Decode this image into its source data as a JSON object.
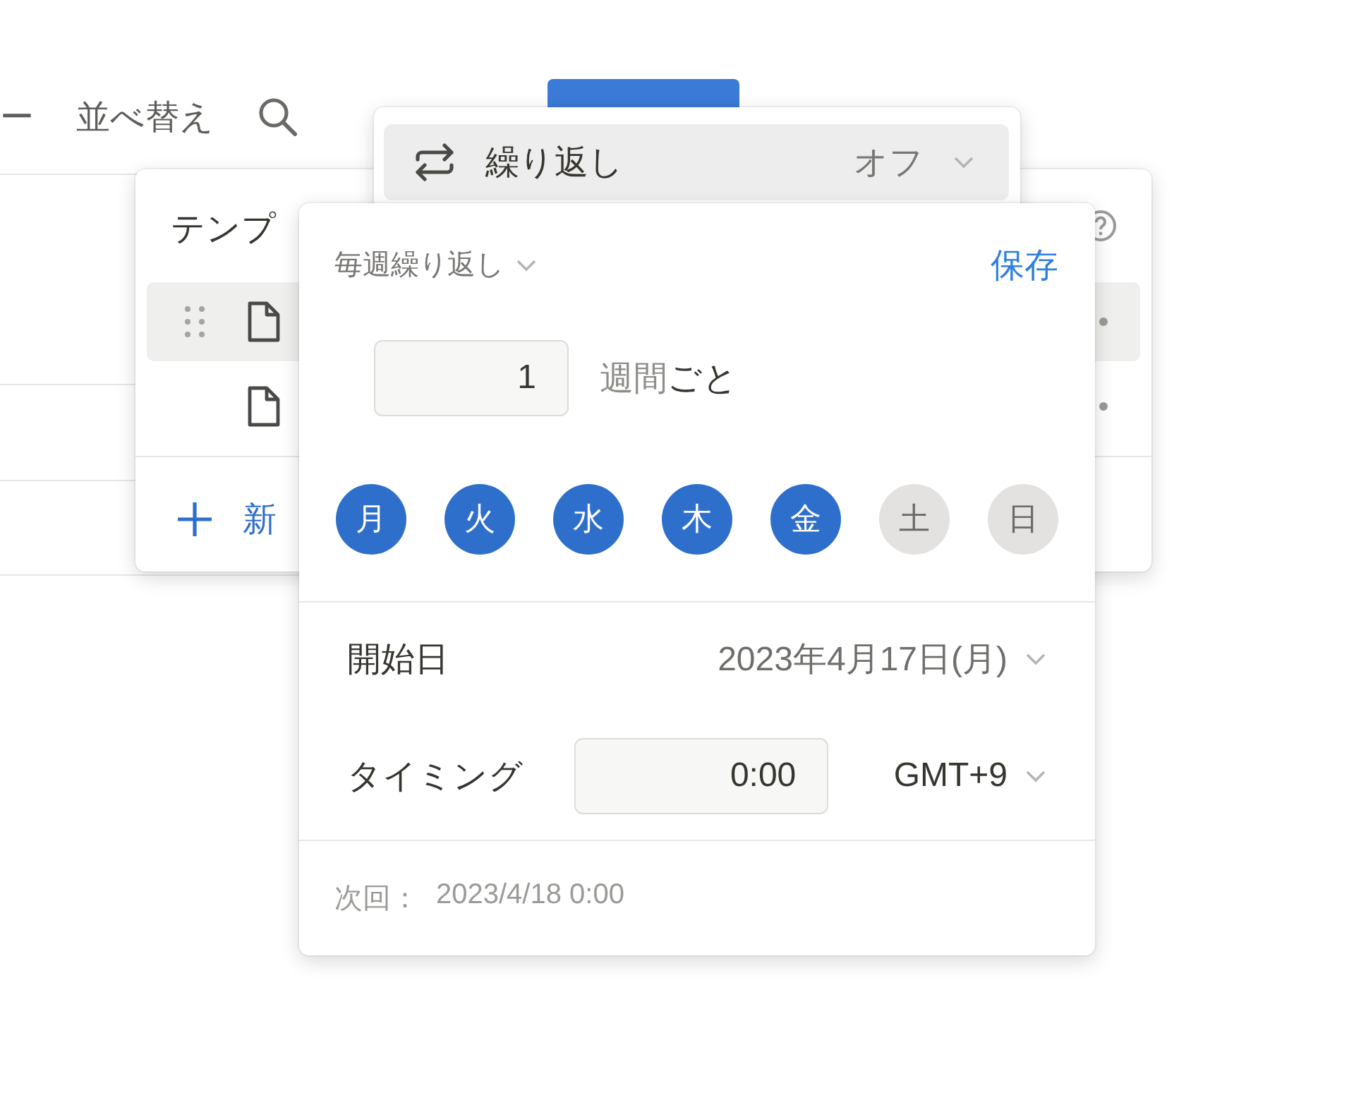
{
  "toolbar": {
    "filter_label": "ー",
    "sort_label": "並べ替え"
  },
  "templates": {
    "title": "テンプ",
    "rows": [
      {
        "selected": true
      },
      {
        "selected": false
      }
    ],
    "add_label": "新"
  },
  "repeat_menu": {
    "label": "繰り返し",
    "value": "オフ",
    "selected": true
  },
  "recurrence": {
    "mode": "毎週繰り返し",
    "save": "保存",
    "interval": {
      "value": "1",
      "unit": "週間",
      "suffix": "ごと"
    },
    "days": [
      {
        "label": "月",
        "selected": true
      },
      {
        "label": "火",
        "selected": true
      },
      {
        "label": "水",
        "selected": true
      },
      {
        "label": "木",
        "selected": true
      },
      {
        "label": "金",
        "selected": true
      },
      {
        "label": "土",
        "selected": false
      },
      {
        "label": "日",
        "selected": false
      }
    ],
    "start": {
      "label": "開始日",
      "value": "2023年4月17日(月)"
    },
    "timing": {
      "label": "タイミング",
      "value": "0:00",
      "timezone": "GMT+9"
    },
    "next": {
      "label": "次回：",
      "value": "2023/4/18 0:00"
    }
  }
}
